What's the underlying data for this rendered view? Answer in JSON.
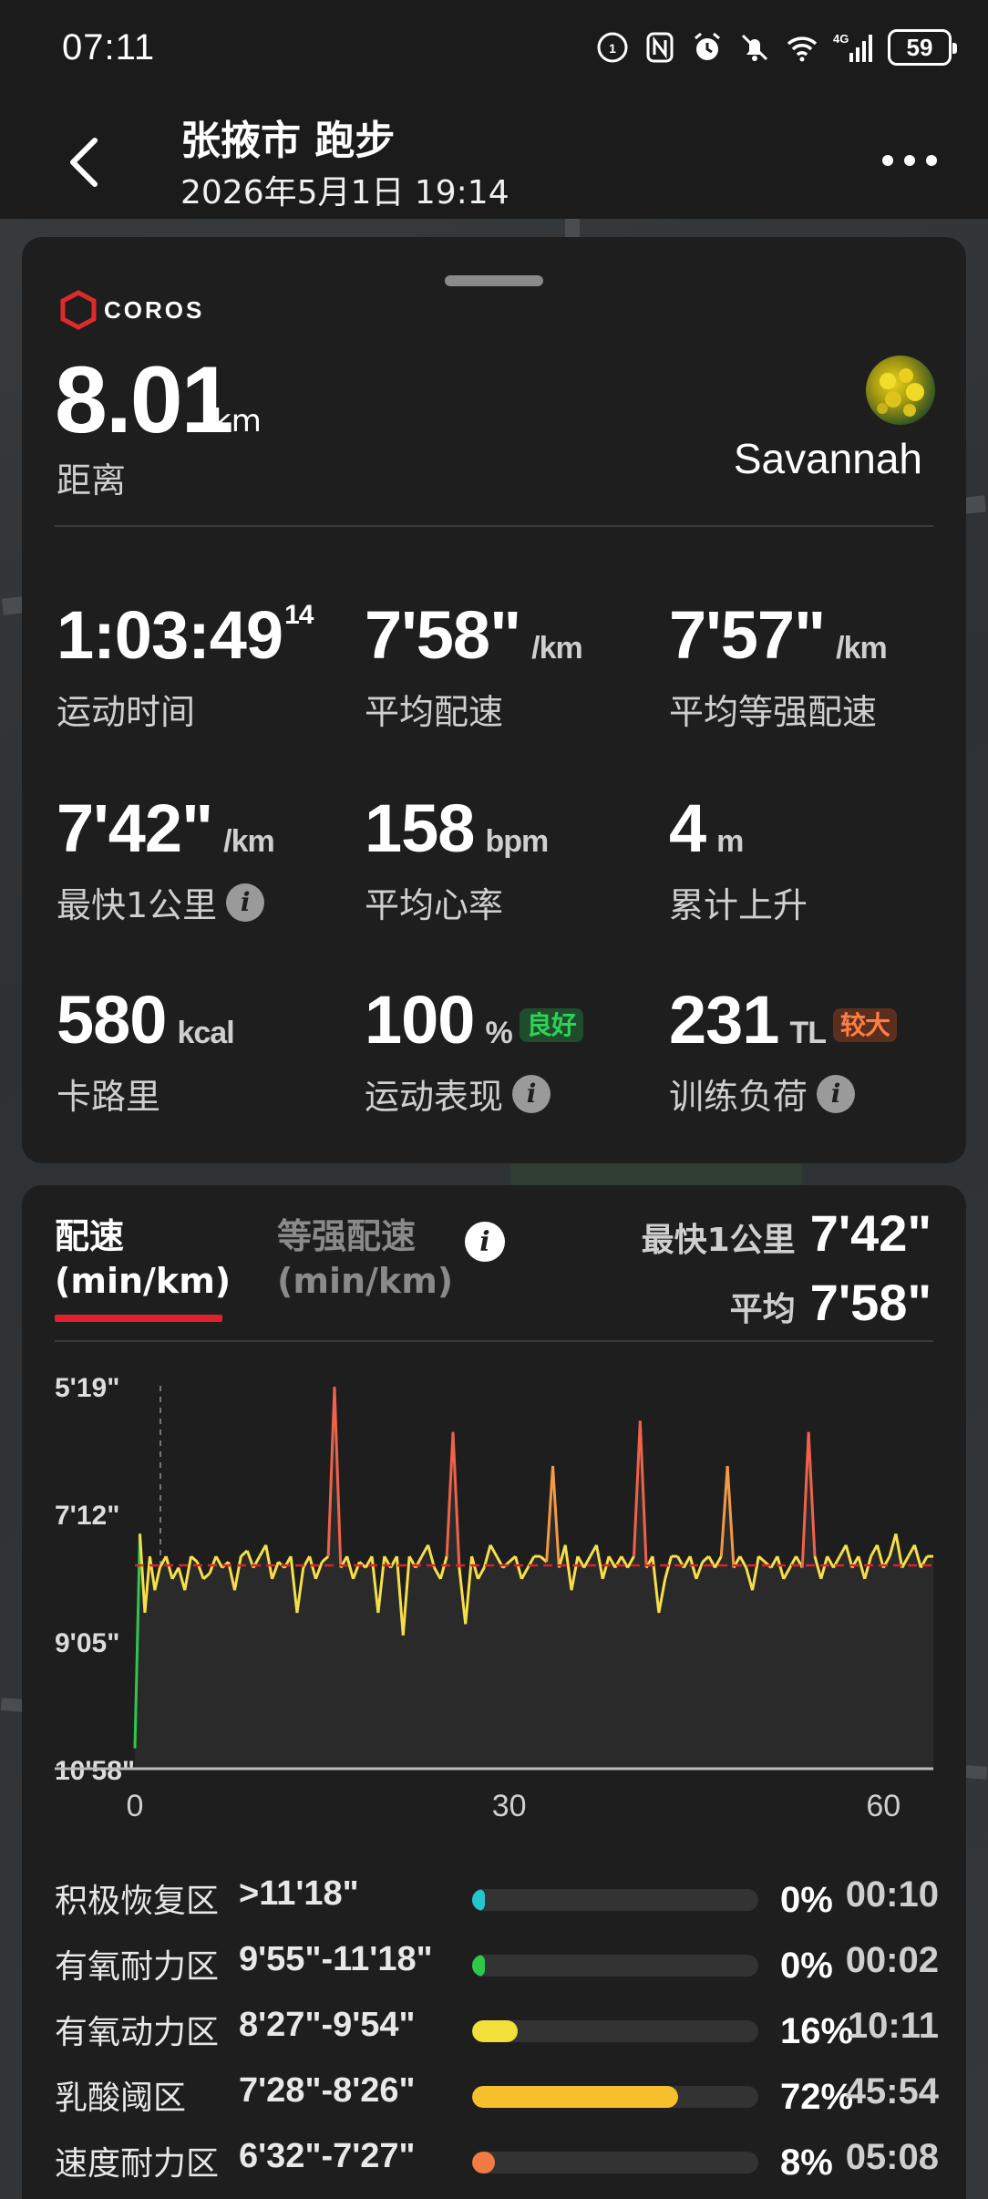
{
  "status_bar": {
    "time": "07:11",
    "battery": "59"
  },
  "header": {
    "title": "张掖市 跑步",
    "subtitle": "2026年5月1日 19:14"
  },
  "summary": {
    "brand": "COROS",
    "distance": "8.01",
    "distance_unit": "km",
    "distance_label": "距离",
    "username": "Savannah"
  },
  "metrics": [
    {
      "value": "1:03:49",
      "sup": "14",
      "unit": "",
      "label": "运动时间"
    },
    {
      "value": "7'58\"",
      "unit": "/km",
      "label": "平均配速"
    },
    {
      "value": "7'57\"",
      "unit": "/km",
      "label": "平均等强配速"
    },
    {
      "value": "7'42\"",
      "unit": "/km",
      "label": "最快1公里",
      "info": true
    },
    {
      "value": "158",
      "unit": "bpm",
      "label": "平均心率"
    },
    {
      "value": "4",
      "unit": "m",
      "label": "累计上升"
    },
    {
      "value": "580",
      "unit": "kcal",
      "label": "卡路里"
    },
    {
      "value": "100",
      "unit": "%",
      "label": "运动表现",
      "tag": "良好",
      "info": true
    },
    {
      "value": "231",
      "unit": "TL",
      "label": "训练负荷",
      "tag": "较大",
      "info": true
    }
  ],
  "pace_card": {
    "tab_active_line1": "配速",
    "tab_active_line2": "(min/km)",
    "tab_inactive_line1": "等强配速",
    "tab_inactive_line2": "(min/km)",
    "fastest_label": "最快1公里",
    "fastest_value": "7'42\"",
    "avg_label": "平均",
    "avg_value": "7'58\""
  },
  "chart_data": {
    "type": "line",
    "xlabel": "",
    "ylabel": "",
    "x_ticks": [
      "0",
      "30",
      "60"
    ],
    "y_ticks": [
      "5'19\"",
      "7'12\"",
      "9'05\"",
      "10'58\""
    ],
    "xlim": [
      0,
      64
    ],
    "ylim_sec": [
      319,
      658
    ],
    "avg_pace_sec": 478,
    "series": [
      {
        "x": [
          0,
          0.4,
          0.8,
          1.2,
          1.6,
          2,
          2.5,
          3,
          3.5,
          4,
          4.5,
          5,
          5.5,
          6,
          6.5,
          7,
          7.5,
          8,
          8.5,
          9,
          9.5,
          10,
          10.5,
          11,
          11.5,
          12,
          12.5,
          13,
          13.5,
          14,
          14.5,
          15,
          15.5,
          16,
          16.5,
          17,
          17.5,
          18,
          18.5,
          19,
          19.5,
          20,
          20.5,
          21,
          21.5,
          22,
          22.5,
          23,
          23.5,
          24,
          24.5,
          25,
          25.5,
          26,
          26.5,
          27,
          27.5,
          28,
          28.5,
          29,
          29.5,
          30,
          30.5,
          31,
          31.5,
          32,
          32.5,
          33,
          33.5,
          34,
          34.5,
          35,
          35.5,
          36,
          36.5,
          37,
          37.5,
          38,
          38.5,
          39,
          39.5,
          40,
          40.5,
          41,
          41.5,
          42,
          42.5,
          43,
          43.5,
          44,
          44.5,
          45,
          45.5,
          46,
          46.5,
          47,
          47.5,
          48,
          48.5,
          49,
          49.5,
          50,
          50.5,
          51,
          51.5,
          52,
          52.5,
          53,
          53.5,
          54,
          54.5,
          55,
          55.5,
          56,
          56.5,
          57,
          57.5,
          58,
          58.5,
          59,
          59.5,
          60,
          60.5,
          61,
          61.5,
          62,
          62.5,
          63,
          63.5,
          64
        ],
        "y": [
          640,
          450,
          520,
          470,
          500,
          480,
          470,
          490,
          480,
          500,
          470,
          475,
          490,
          485,
          470,
          480,
          475,
          500,
          470,
          465,
          480,
          470,
          460,
          490,
          475,
          480,
          470,
          520,
          480,
          470,
          490,
          475,
          470,
          320,
          480,
          470,
          490,
          475,
          480,
          470,
          520,
          470,
          480,
          470,
          540,
          470,
          480,
          470,
          460,
          480,
          490,
          470,
          360,
          480,
          530,
          470,
          490,
          480,
          460,
          470,
          480,
          475,
          470,
          490,
          480,
          470,
          470,
          475,
          390,
          480,
          460,
          500,
          470,
          480,
          470,
          460,
          490,
          470,
          480,
          470,
          480,
          470,
          350,
          480,
          470,
          520,
          490,
          470,
          470,
          480,
          470,
          490,
          475,
          470,
          480,
          470,
          390,
          480,
          470,
          480,
          500,
          470,
          475,
          480,
          470,
          490,
          480,
          470,
          480,
          360,
          470,
          490,
          470,
          480,
          470,
          460,
          480,
          470,
          490,
          470,
          460,
          480,
          470,
          450,
          480,
          470,
          460,
          480,
          470,
          470
        ]
      }
    ]
  },
  "zones": [
    {
      "name": "积极恢复区",
      "range": ">11'18\"",
      "pct_value": 0.02,
      "pct": "0%",
      "time": "00:10",
      "color": "#25c5d0"
    },
    {
      "name": "有氧耐力区",
      "range": "9'55\"-11'18\"",
      "pct_value": 0.02,
      "pct": "0%",
      "time": "00:02",
      "color": "#2fc94a"
    },
    {
      "name": "有氧动力区",
      "range": "8'27\"-9'54\"",
      "pct_value": 0.16,
      "pct": "16%",
      "time": "10:11",
      "color": "#f2df3a"
    },
    {
      "name": "乳酸阈区",
      "range": "7'28\"-8'26\"",
      "pct_value": 0.72,
      "pct": "72%",
      "time": "45:54",
      "color": "#f5c02b"
    },
    {
      "name": "速度耐力区",
      "range": "6'32\"-7'27\"",
      "pct_value": 0.08,
      "pct": "8%",
      "time": "05:08",
      "color": "#f27a45"
    }
  ]
}
